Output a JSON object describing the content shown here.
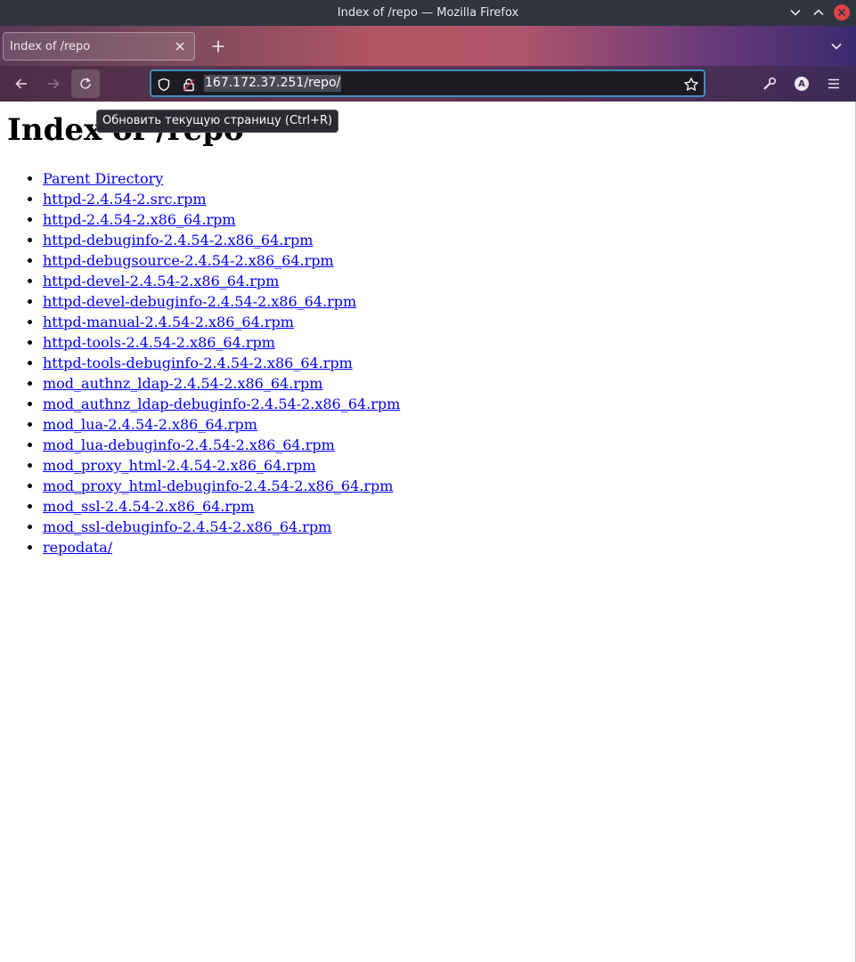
{
  "window": {
    "title": "Index of /repo — Mozilla Firefox"
  },
  "tabs": [
    {
      "label": "Index of /repo"
    }
  ],
  "navbar": {
    "url": "167.172.37.251/repo/"
  },
  "tooltip": "Обновить текущую страницу (Ctrl+R)",
  "account_initial": "A",
  "page": {
    "heading": "Index of /repo",
    "links": [
      "Parent Directory",
      "httpd-2.4.54-2.src.rpm",
      "httpd-2.4.54-2.x86_64.rpm",
      "httpd-debuginfo-2.4.54-2.x86_64.rpm",
      "httpd-debugsource-2.4.54-2.x86_64.rpm",
      "httpd-devel-2.4.54-2.x86_64.rpm",
      "httpd-devel-debuginfo-2.4.54-2.x86_64.rpm",
      "httpd-manual-2.4.54-2.x86_64.rpm",
      "httpd-tools-2.4.54-2.x86_64.rpm",
      "httpd-tools-debuginfo-2.4.54-2.x86_64.rpm",
      "mod_authnz_ldap-2.4.54-2.x86_64.rpm",
      "mod_authnz_ldap-debuginfo-2.4.54-2.x86_64.rpm",
      "mod_lua-2.4.54-2.x86_64.rpm",
      "mod_lua-debuginfo-2.4.54-2.x86_64.rpm",
      "mod_proxy_html-2.4.54-2.x86_64.rpm",
      "mod_proxy_html-debuginfo-2.4.54-2.x86_64.rpm",
      "mod_ssl-2.4.54-2.x86_64.rpm",
      "mod_ssl-debuginfo-2.4.54-2.x86_64.rpm",
      "repodata/"
    ]
  },
  "icons": {
    "back": "back-arrow-icon",
    "forward": "forward-arrow-icon",
    "reload": "reload-icon",
    "shield": "tracking-protection-shield-icon",
    "lock": "insecure-lock-icon",
    "bookmark": "bookmark-star-icon",
    "tools": "wrench-icon",
    "menu": "hamburger-menu-icon"
  },
  "colors": {
    "link": "#0000ee",
    "url_focus_border": "#3d8fbf",
    "close_button": "#e0444a"
  }
}
